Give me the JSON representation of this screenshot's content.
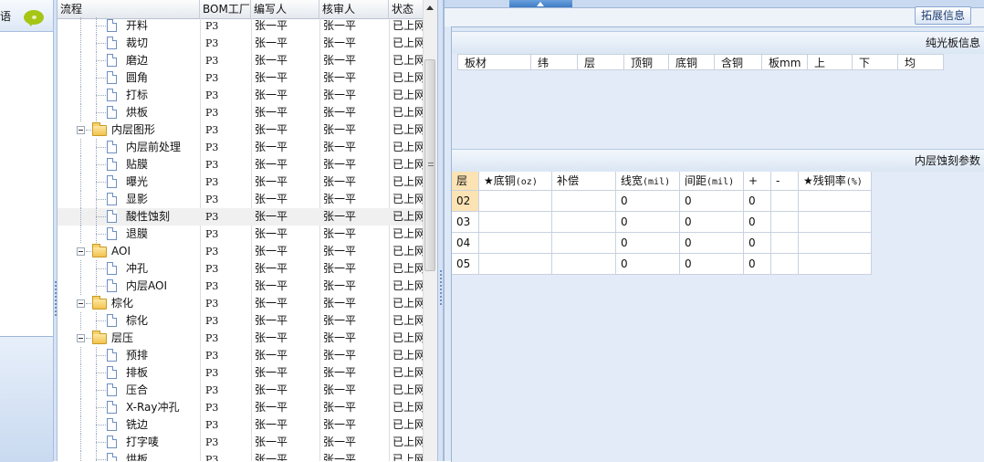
{
  "left_strip": {
    "cut_label": "语"
  },
  "tree": {
    "columns": [
      "流程",
      "BOM工厂",
      "编写人",
      "核审人",
      "状态"
    ],
    "rows": [
      {
        "kind": "file",
        "level": 2,
        "label": "开料",
        "bom": "P3",
        "writer": "张一平",
        "reviewer": "张一平",
        "status": "已上网"
      },
      {
        "kind": "file",
        "level": 2,
        "label": "裁切",
        "bom": "P3",
        "writer": "张一平",
        "reviewer": "张一平",
        "status": "已上网"
      },
      {
        "kind": "file",
        "level": 2,
        "label": "磨边",
        "bom": "P3",
        "writer": "张一平",
        "reviewer": "张一平",
        "status": "已上网"
      },
      {
        "kind": "file",
        "level": 2,
        "label": "圆角",
        "bom": "P3",
        "writer": "张一平",
        "reviewer": "张一平",
        "status": "已上网"
      },
      {
        "kind": "file",
        "level": 2,
        "label": "打标",
        "bom": "P3",
        "writer": "张一平",
        "reviewer": "张一平",
        "status": "已上网"
      },
      {
        "kind": "file",
        "level": 2,
        "label": "烘板",
        "bom": "P3",
        "writer": "张一平",
        "reviewer": "张一平",
        "status": "已上网"
      },
      {
        "kind": "folder",
        "level": 1,
        "label": "内层图形",
        "bom": "P3",
        "writer": "张一平",
        "reviewer": "张一平",
        "status": "已上网"
      },
      {
        "kind": "file",
        "level": 2,
        "label": "内层前处理",
        "bom": "P3",
        "writer": "张一平",
        "reviewer": "张一平",
        "status": "已上网"
      },
      {
        "kind": "file",
        "level": 2,
        "label": "贴膜",
        "bom": "P3",
        "writer": "张一平",
        "reviewer": "张一平",
        "status": "已上网"
      },
      {
        "kind": "file",
        "level": 2,
        "label": "曝光",
        "bom": "P3",
        "writer": "张一平",
        "reviewer": "张一平",
        "status": "已上网"
      },
      {
        "kind": "file",
        "level": 2,
        "label": "显影",
        "bom": "P3",
        "writer": "张一平",
        "reviewer": "张一平",
        "status": "已上网"
      },
      {
        "kind": "file",
        "level": 2,
        "label": "酸性蚀刻",
        "bom": "P3",
        "writer": "张一平",
        "reviewer": "张一平",
        "status": "已上网",
        "selected": true
      },
      {
        "kind": "file",
        "level": 2,
        "label": "退膜",
        "bom": "P3",
        "writer": "张一平",
        "reviewer": "张一平",
        "status": "已上网"
      },
      {
        "kind": "folder",
        "level": 1,
        "label": "AOI",
        "bom": "P3",
        "writer": "张一平",
        "reviewer": "张一平",
        "status": "已上网"
      },
      {
        "kind": "file",
        "level": 2,
        "label": "冲孔",
        "bom": "P3",
        "writer": "张一平",
        "reviewer": "张一平",
        "status": "已上网"
      },
      {
        "kind": "file",
        "level": 2,
        "label": "内层AOI",
        "bom": "P3",
        "writer": "张一平",
        "reviewer": "张一平",
        "status": "已上网"
      },
      {
        "kind": "folder",
        "level": 1,
        "label": "棕化",
        "bom": "P3",
        "writer": "张一平",
        "reviewer": "张一平",
        "status": "已上网"
      },
      {
        "kind": "file",
        "level": 2,
        "label": "棕化",
        "bom": "P3",
        "writer": "张一平",
        "reviewer": "张一平",
        "status": "已上网"
      },
      {
        "kind": "folder",
        "level": 1,
        "label": "层压",
        "bom": "P3",
        "writer": "张一平",
        "reviewer": "张一平",
        "status": "已上网"
      },
      {
        "kind": "file",
        "level": 2,
        "label": "预排",
        "bom": "P3",
        "writer": "张一平",
        "reviewer": "张一平",
        "status": "已上网"
      },
      {
        "kind": "file",
        "level": 2,
        "label": "排板",
        "bom": "P3",
        "writer": "张一平",
        "reviewer": "张一平",
        "status": "已上网"
      },
      {
        "kind": "file",
        "level": 2,
        "label": "压合",
        "bom": "P3",
        "writer": "张一平",
        "reviewer": "张一平",
        "status": "已上网"
      },
      {
        "kind": "file",
        "level": 2,
        "label": "X-Ray冲孔",
        "bom": "P3",
        "writer": "张一平",
        "reviewer": "张一平",
        "status": "已上网"
      },
      {
        "kind": "file",
        "level": 2,
        "label": "铣边",
        "bom": "P3",
        "writer": "张一平",
        "reviewer": "张一平",
        "status": "已上网"
      },
      {
        "kind": "file",
        "level": 2,
        "label": "打字唛",
        "bom": "P3",
        "writer": "张一平",
        "reviewer": "张一平",
        "status": "已上网"
      },
      {
        "kind": "file",
        "level": 2,
        "label": "烘板",
        "bom": "P3",
        "writer": "张一平",
        "reviewer": "张一平",
        "status": "已上网"
      }
    ]
  },
  "right": {
    "extend_button": "拓展信息",
    "section1": {
      "title": "纯光板信息",
      "columns": [
        "板材",
        "纬",
        "层",
        "顶铜",
        "底铜",
        "含铜",
        "板mm",
        "上",
        "下",
        "均"
      ]
    },
    "section2": {
      "title": "内层蚀刻参数",
      "columns": [
        {
          "main": "层",
          "unit": ""
        },
        {
          "main": "★底铜",
          "unit": "(oz)"
        },
        {
          "main": "补偿",
          "unit": ""
        },
        {
          "main": "线宽",
          "unit": "(mil)"
        },
        {
          "main": "间距",
          "unit": "(mil)"
        },
        {
          "main": "+",
          "unit": ""
        },
        {
          "main": "-",
          "unit": ""
        },
        {
          "main": "★残铜率",
          "unit": "(%)"
        }
      ],
      "rows": [
        {
          "layer": "02",
          "base_cu": "",
          "comp": "",
          "line_width": "0",
          "spacing": "0",
          "plus": "0",
          "minus": "",
          "residual": ""
        },
        {
          "layer": "03",
          "base_cu": "",
          "comp": "",
          "line_width": "0",
          "spacing": "0",
          "plus": "0",
          "minus": "",
          "residual": ""
        },
        {
          "layer": "04",
          "base_cu": "",
          "comp": "",
          "line_width": "0",
          "spacing": "0",
          "plus": "0",
          "minus": "",
          "residual": ""
        },
        {
          "layer": "05",
          "base_cu": "",
          "comp": "",
          "line_width": "0",
          "spacing": "0",
          "plus": "0",
          "minus": "",
          "residual": ""
        }
      ]
    }
  }
}
